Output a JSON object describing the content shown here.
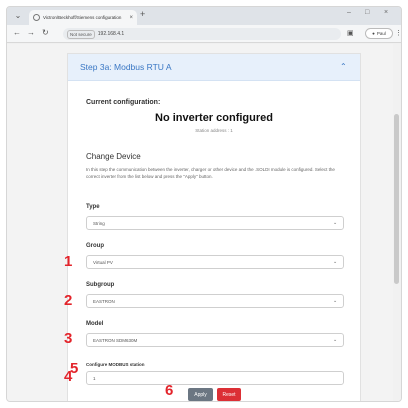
{
  "browser": {
    "tab_title": "Victron/Beckhoff/Siemens configuration",
    "tab_close": "×",
    "new_tab": "+",
    "window_controls": [
      "–",
      "□",
      "×"
    ],
    "nav_back": "←",
    "nav_forward": "→",
    "nav_reload": "↻",
    "security_badge": "Not secure",
    "url": "192.168.4.1",
    "profile_label": "Paul",
    "menu_icon": "⋮"
  },
  "panel": {
    "title": "Step 3a: Modbus RTU A",
    "collapse_icon": "⌃"
  },
  "current_config": {
    "heading": "Current configuration:",
    "status": "No inverter configured",
    "station_note": "Station address : 1"
  },
  "change_device": {
    "heading": "Change Device",
    "description": "In this step the communication between the inverter, charger or other device and the .SOLDI module is configured. Select the correct inverter from the list below and press the \"Apply\" button."
  },
  "fields": {
    "type": {
      "label": "Type",
      "value": "String",
      "marker": "1"
    },
    "group": {
      "label": "Group",
      "value": "Virtual PV",
      "marker": "2"
    },
    "subgroup": {
      "label": "Subgroup",
      "value": "EASTRON",
      "marker": "3"
    },
    "model": {
      "label": "Model",
      "value": "EASTRON SDM630M",
      "marker": "4"
    },
    "station": {
      "label": "Configure MODBUS station",
      "value": "1",
      "marker": "5"
    }
  },
  "actions": {
    "marker": "6",
    "apply_label": "Apply",
    "reset_label": "Reset"
  },
  "colors": {
    "accent_blue": "#3a77c4",
    "marker_red": "#e3242b",
    "reset_red": "#dc2f35",
    "apply_gray": "#6b7682"
  }
}
